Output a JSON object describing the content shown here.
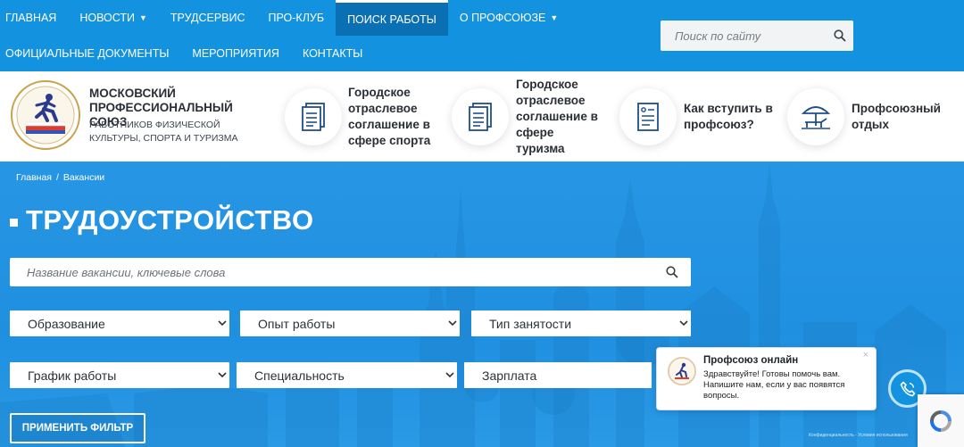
{
  "nav": {
    "row1": [
      {
        "label": "ГЛАВНАЯ"
      },
      {
        "label": "НОВОСТИ",
        "dropdown": true
      },
      {
        "label": "ТРУДСЕРВИС"
      },
      {
        "label": "ПРО-КЛУБ"
      },
      {
        "label": "ПОИСК РАБОТЫ",
        "active": true
      },
      {
        "label": "О ПРОФСОЮЗЕ",
        "dropdown": true
      }
    ],
    "row2": [
      {
        "label": "ОФИЦИАЛЬНЫЕ ДОКУМЕНТЫ"
      },
      {
        "label": "МЕРОПРИЯТИЯ"
      },
      {
        "label": "КОНТАКТЫ"
      }
    ],
    "caret": "▼"
  },
  "site_search": {
    "placeholder": "Поиск по сайту",
    "icon": "search-icon"
  },
  "header": {
    "title": "МОСКОВСКИЙ ПРОФЕССИОНАЛЬНЫЙ СОЮЗ",
    "subtitle": "РАБОТНИКОВ ФИЗИЧЕСКОЙ КУЛЬТУРЫ, СПОРТА И ТУРИЗМА",
    "logo_text": "МОСПРОФСПОРТТУР",
    "links": [
      {
        "label": "Городское отраслевое соглашение в сфере спорта",
        "icon": "document-icon"
      },
      {
        "label": "Городское отраслевое соглашение в сфере туризма",
        "icon": "document-icon"
      },
      {
        "label": "Как вступить в профсоюз?",
        "icon": "form-icon"
      },
      {
        "label": "Профсоюзный отдых",
        "icon": "beach-umbrella-icon"
      }
    ]
  },
  "breadcrumb": {
    "home": "Главная",
    "sep": "/",
    "current": "Вакансии"
  },
  "page_title": "ТРУДОУСТРОЙСТВО",
  "job_search": {
    "placeholder": "Название вакансии, ключевые слова"
  },
  "filters": {
    "education": "Образование",
    "experience": "Опыт работы",
    "employment_type": "Тип занятости",
    "schedule": "График работы",
    "specialty": "Специальность",
    "salary": "Зарплата"
  },
  "apply_label": "ПРИМЕНИТЬ ФИЛЬТР",
  "chat": {
    "title": "Профсоюз онлайн",
    "message": "Здравствуйте! Готовы помочь вам. Напишите нам, если у вас появятся вопросы.",
    "close": "×"
  },
  "recaptcha_note": "Конфиденциальность - Условия использования",
  "colors": {
    "brand": "#1393df",
    "nav_active": "#0a6fb3",
    "hero": "#2796e4"
  }
}
